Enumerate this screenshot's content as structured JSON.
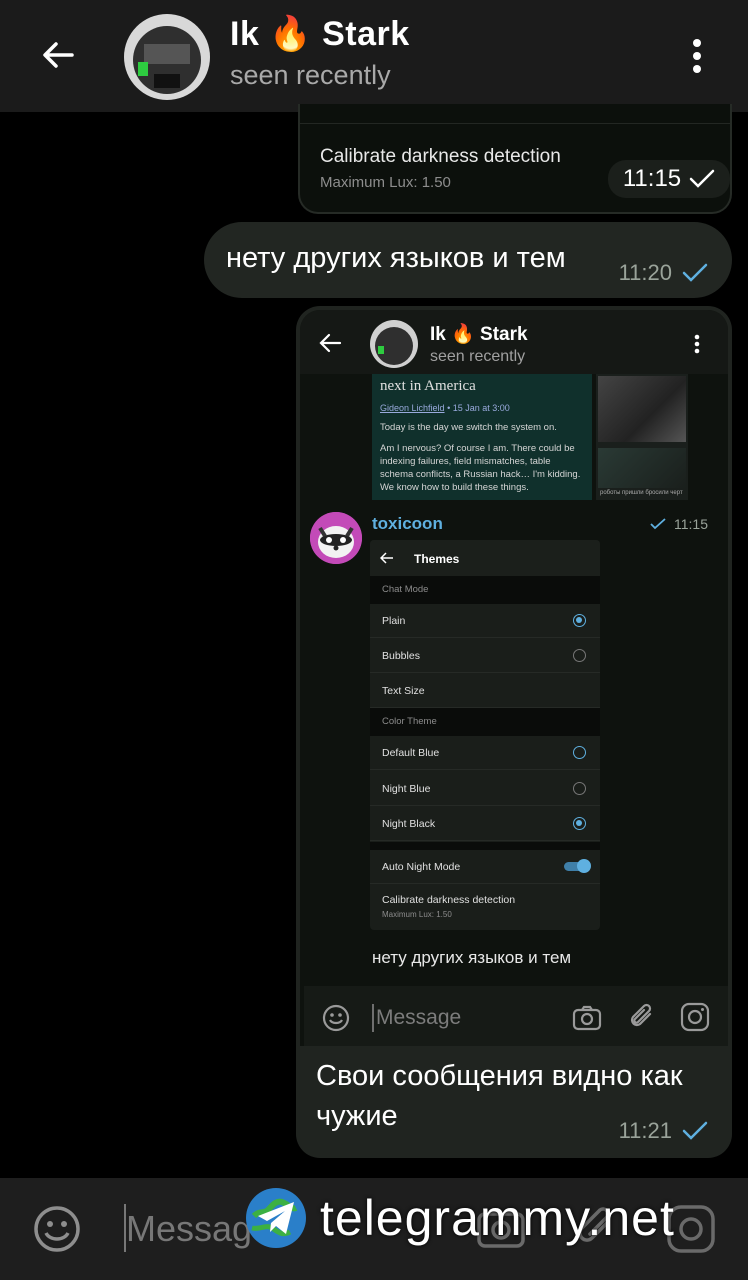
{
  "header": {
    "title": "Ik 🔥 Stark",
    "status": "seen recently"
  },
  "messages": {
    "m1": {
      "setting_title": "Calibrate darkness detection",
      "setting_sub": "Maximum Lux: 1.50",
      "time": "11:15"
    },
    "m2": {
      "text": "нету других языков и тем",
      "time": "11:20"
    },
    "m3": {
      "text": "Свои сообщения видно как чужие",
      "time": "11:21"
    }
  },
  "screenshot": {
    "header_title": "Ik 🔥 Stark",
    "header_status": "seen recently",
    "article": {
      "title": "next in America",
      "meta_author": "Gideon Lichfield",
      "meta_date": "• 15 Jan at 3:00",
      "p1": "Today is the day we switch the system on.",
      "p2": "Am I nervous? Of course I am. There could be indexing failures, field mismatches, table schema conflicts, a Russian hack… I'm kidding. We know how to build these things."
    },
    "thumb_caption": "роботы пришли бросили черт",
    "sender": "toxicoon",
    "time": "11:15",
    "themes": {
      "title": "Themes",
      "chat_mode": "Chat Mode",
      "plain": "Plain",
      "bubbles": "Bubbles",
      "text_size": "Text Size",
      "color_theme": "Color Theme",
      "default_blue": "Default Blue",
      "night_blue": "Night Blue",
      "night_black": "Night Black",
      "auto_night": "Auto Night Mode",
      "calibrate": "Calibrate darkness detection",
      "max_lux": "Maximum Lux: 1.50"
    },
    "message": "нету других языков и тем",
    "input_placeholder": "Message"
  },
  "input": {
    "placeholder": "Message"
  },
  "watermark": "telegrammy.net",
  "colors": {
    "accent": "#5fb0e0",
    "header_bg": "#1b1b1b",
    "bubble_bg": "#222622"
  }
}
